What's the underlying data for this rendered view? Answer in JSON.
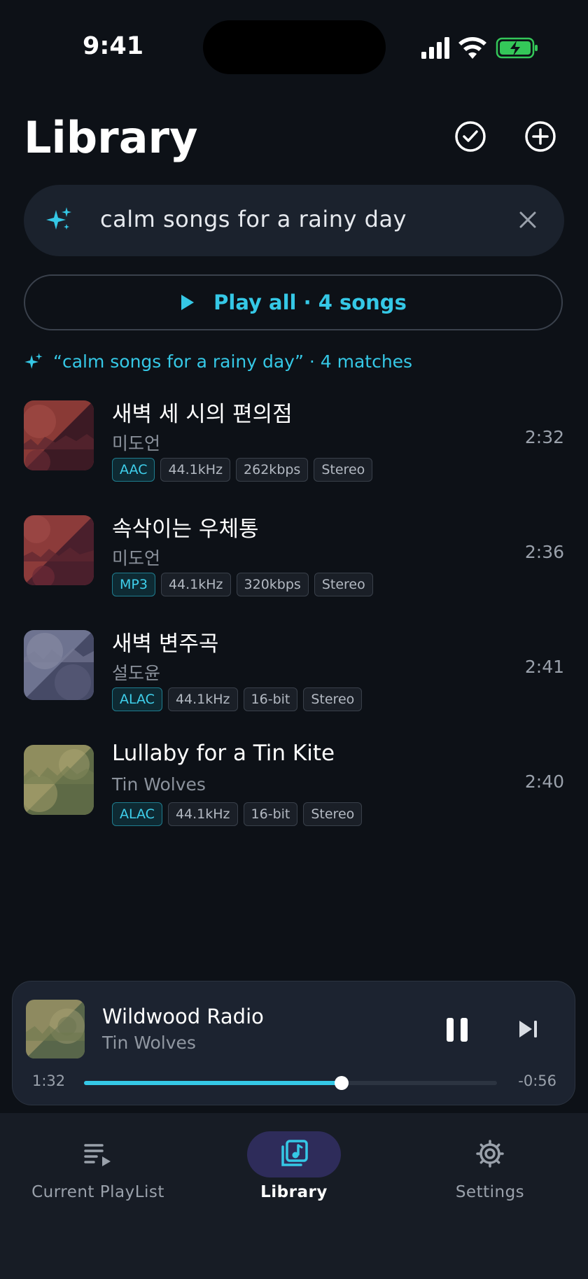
{
  "status_bar": {
    "time": "9:41"
  },
  "header": {
    "title": "Library"
  },
  "search": {
    "query": "calm songs for a rainy day"
  },
  "play_all": {
    "label": "Play all · 4 songs"
  },
  "matches_line": "“calm songs for a rainy day” · 4 matches",
  "songs": [
    {
      "title": "새벽 세 시의 편의점",
      "artist": "미도언",
      "duration": "2:32",
      "tags": [
        "AAC",
        "44.1kHz",
        "262kbps",
        "Stereo"
      ]
    },
    {
      "title": "속삭이는 우체통",
      "artist": "미도언",
      "duration": "2:36",
      "tags": [
        "MP3",
        "44.1kHz",
        "320kbps",
        "Stereo"
      ]
    },
    {
      "title": "새벽 변주곡",
      "artist": "설도윤",
      "duration": "2:41",
      "tags": [
        "ALAC",
        "44.1kHz",
        "16-bit",
        "Stereo"
      ]
    },
    {
      "title": "Lullaby for a Tin Kite",
      "artist": "Tin Wolves",
      "duration": "2:40",
      "tags": [
        "ALAC",
        "44.1kHz",
        "16-bit",
        "Stereo"
      ]
    }
  ],
  "now_playing": {
    "title": "Wildwood Radio",
    "artist": "Tin Wolves",
    "elapsed": "1:32",
    "remaining": "-0:56",
    "progress": 0.623
  },
  "tabs": [
    {
      "label": "Current PlayList",
      "icon": "playlist-icon"
    },
    {
      "label": "Library",
      "icon": "library-icon",
      "active": true
    },
    {
      "label": "Settings",
      "icon": "gear-icon"
    }
  ],
  "colors": {
    "accent": "#35c8e6",
    "background": "#0d1117",
    "active_tab_pill": "#2e2c5a"
  }
}
